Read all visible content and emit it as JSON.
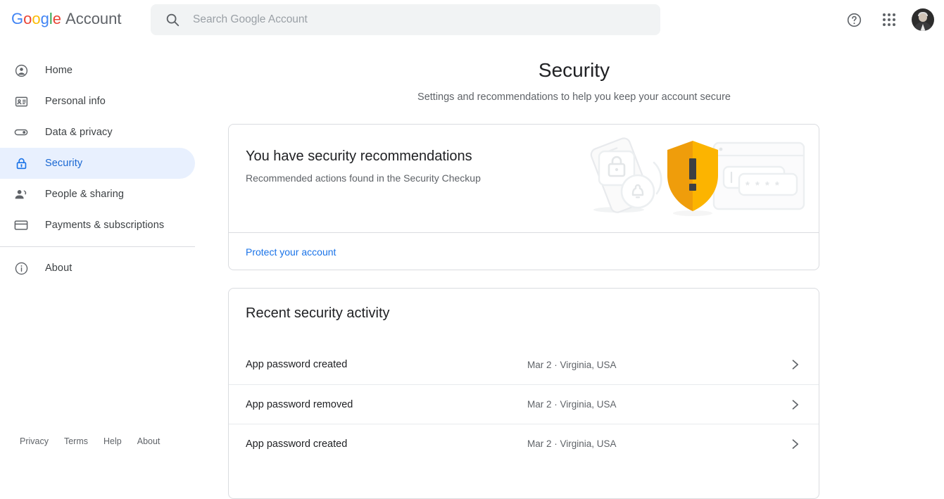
{
  "header": {
    "brand_google": "Google",
    "brand_word": "Account",
    "search_placeholder": "Search Google Account",
    "search_value": "",
    "help_icon": "help-icon",
    "apps_icon": "apps-grid-icon",
    "avatar_icon": "account-avatar"
  },
  "sidebar": {
    "items": [
      {
        "label": "Home",
        "icon": "account-circle-icon",
        "active": false
      },
      {
        "label": "Personal info",
        "icon": "badge-icon",
        "active": false
      },
      {
        "label": "Data & privacy",
        "icon": "toggle-icon",
        "active": false
      },
      {
        "label": "Security",
        "icon": "lock-icon",
        "active": true
      },
      {
        "label": "People & sharing",
        "icon": "people-icon",
        "active": false
      },
      {
        "label": "Payments & subscriptions",
        "icon": "credit-card-icon",
        "active": false
      },
      {
        "label": "About",
        "icon": "info-icon",
        "active": false
      }
    ],
    "footer_links": [
      "Privacy",
      "Terms",
      "Help",
      "About"
    ]
  },
  "main": {
    "title": "Security",
    "subtitle": "Settings and recommendations to help you keep your account secure",
    "recommendations": {
      "title": "You have security recommendations",
      "subtitle": "Recommended actions found in the Security Checkup",
      "link": "Protect your account",
      "illustration": "security-shield-illustration"
    },
    "activity": {
      "title": "Recent security activity",
      "rows": [
        {
          "name": "App password created",
          "meta": "Mar 2 · Virginia, USA"
        },
        {
          "name": "App password removed",
          "meta": "Mar 2 · Virginia, USA"
        },
        {
          "name": "App password created",
          "meta": "Mar 2 · Virginia, USA"
        }
      ]
    }
  },
  "colors": {
    "accent": "#1a73e8",
    "active_pill": "#e8f0fe",
    "warning_shield": "#fbb400",
    "warning_shield_dark": "#f0a01a",
    "text_primary": "#202124",
    "text_secondary": "#5f6368",
    "border": "#dadce0"
  }
}
